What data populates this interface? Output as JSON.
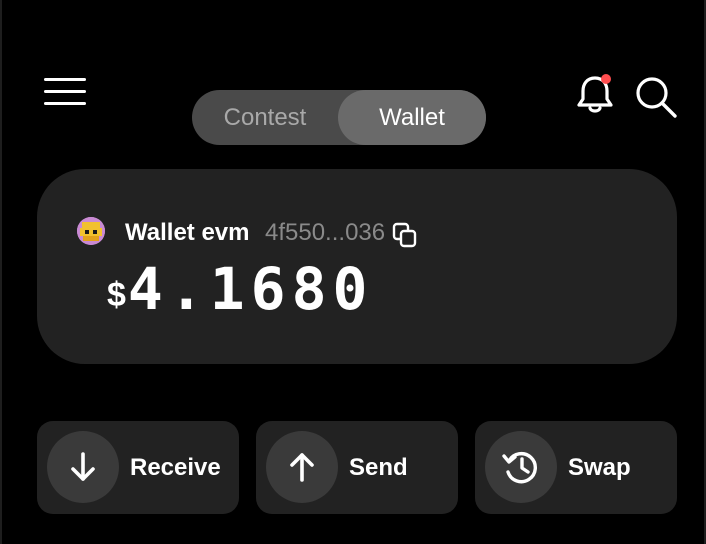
{
  "header": {
    "menu_icon": "hamburger-menu-icon",
    "tabs": [
      {
        "label": "Contest",
        "selected": false
      },
      {
        "label": "Wallet",
        "selected": true
      }
    ],
    "notification_icon": "bell-icon",
    "notification_dot_color": "#ff4d4f",
    "search_icon": "search-icon"
  },
  "wallet": {
    "name": "Wallet evm",
    "address_short": "4f550...036",
    "copy_icon": "copy-icon",
    "currency_symbol": "$",
    "balance": "4.1680"
  },
  "actions": [
    {
      "label": "Receive",
      "icon": "arrow-down-icon"
    },
    {
      "label": "Send",
      "icon": "arrow-up-icon"
    },
    {
      "label": "Swap",
      "icon": "history-icon"
    }
  ],
  "colors": {
    "background": "#000000",
    "card": "#222222",
    "toggle_bg": "#4a4a4a",
    "toggle_selected": "#6a6a6a",
    "muted_text": "#8a8a8a"
  }
}
